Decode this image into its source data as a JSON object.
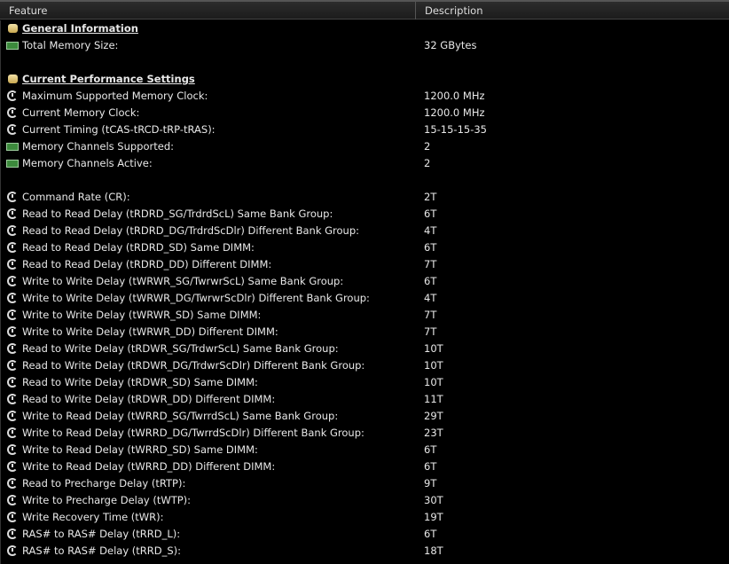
{
  "header": {
    "feature": "Feature",
    "description": "Description"
  },
  "rows": [
    {
      "type": "section",
      "icon": "database-icon",
      "label": "General Information",
      "value": ""
    },
    {
      "type": "item",
      "icon": "memory-module-icon",
      "label": "Total Memory Size:",
      "value": "32 GBytes"
    },
    {
      "type": "blank",
      "label": "",
      "value": ""
    },
    {
      "type": "section",
      "icon": "database-icon",
      "label": "Current Performance Settings",
      "value": ""
    },
    {
      "type": "item",
      "icon": "clock-icon",
      "label": "Maximum Supported Memory Clock:",
      "value": "1200.0 MHz"
    },
    {
      "type": "item",
      "icon": "clock-icon",
      "label": "Current Memory Clock:",
      "value": "1200.0 MHz"
    },
    {
      "type": "item",
      "icon": "clock-icon",
      "label": "Current Timing (tCAS-tRCD-tRP-tRAS):",
      "value": "15-15-15-35"
    },
    {
      "type": "item",
      "icon": "memory-module-icon",
      "label": "Memory Channels Supported:",
      "value": "2"
    },
    {
      "type": "item",
      "icon": "memory-module-icon",
      "label": "Memory Channels Active:",
      "value": "2"
    },
    {
      "type": "blank",
      "label": "",
      "value": ""
    },
    {
      "type": "item",
      "icon": "clock-icon",
      "label": "Command Rate (CR):",
      "value": "2T"
    },
    {
      "type": "item",
      "icon": "clock-icon",
      "label": "Read to Read Delay (tRDRD_SG/TrdrdScL) Same Bank Group:",
      "value": "6T"
    },
    {
      "type": "item",
      "icon": "clock-icon",
      "label": "Read to Read Delay (tRDRD_DG/TrdrdScDlr) Different Bank Group:",
      "value": "4T"
    },
    {
      "type": "item",
      "icon": "clock-icon",
      "label": "Read to Read Delay (tRDRD_SD) Same DIMM:",
      "value": "6T"
    },
    {
      "type": "item",
      "icon": "clock-icon",
      "label": "Read to Read Delay (tRDRD_DD) Different DIMM:",
      "value": "7T"
    },
    {
      "type": "item",
      "icon": "clock-icon",
      "label": "Write to Write Delay (tWRWR_SG/TwrwrScL) Same Bank Group:",
      "value": "6T"
    },
    {
      "type": "item",
      "icon": "clock-icon",
      "label": "Write to Write Delay (tWRWR_DG/TwrwrScDlr) Different Bank Group:",
      "value": "4T"
    },
    {
      "type": "item",
      "icon": "clock-icon",
      "label": "Write to Write Delay (tWRWR_SD) Same DIMM:",
      "value": "7T"
    },
    {
      "type": "item",
      "icon": "clock-icon",
      "label": "Write to Write Delay (tWRWR_DD) Different DIMM:",
      "value": "7T"
    },
    {
      "type": "item",
      "icon": "clock-icon",
      "label": "Read to Write Delay (tRDWR_SG/TrdwrScL) Same Bank Group:",
      "value": "10T"
    },
    {
      "type": "item",
      "icon": "clock-icon",
      "label": "Read to Write Delay (tRDWR_DG/TrdwrScDlr) Different Bank Group:",
      "value": "10T"
    },
    {
      "type": "item",
      "icon": "clock-icon",
      "label": "Read to Write Delay (tRDWR_SD) Same DIMM:",
      "value": "10T"
    },
    {
      "type": "item",
      "icon": "clock-icon",
      "label": "Read to Write Delay (tRDWR_DD) Different DIMM:",
      "value": "11T"
    },
    {
      "type": "item",
      "icon": "clock-icon",
      "label": "Write to Read Delay (tWRRD_SG/TwrrdScL) Same Bank Group:",
      "value": "29T"
    },
    {
      "type": "item",
      "icon": "clock-icon",
      "label": "Write to Read Delay (tWRRD_DG/TwrrdScDlr) Different Bank Group:",
      "value": "23T"
    },
    {
      "type": "item",
      "icon": "clock-icon",
      "label": "Write to Read Delay (tWRRD_SD) Same DIMM:",
      "value": "6T"
    },
    {
      "type": "item",
      "icon": "clock-icon",
      "label": "Write to Read Delay (tWRRD_DD) Different DIMM:",
      "value": "6T"
    },
    {
      "type": "item",
      "icon": "clock-icon",
      "label": "Read to Precharge Delay (tRTP):",
      "value": "9T"
    },
    {
      "type": "item",
      "icon": "clock-icon",
      "label": "Write to Precharge Delay (tWTP):",
      "value": "30T"
    },
    {
      "type": "item",
      "icon": "clock-icon",
      "label": "Write Recovery Time (tWR):",
      "value": "19T"
    },
    {
      "type": "item",
      "icon": "clock-icon",
      "label": "RAS# to RAS# Delay (tRRD_L):",
      "value": "6T"
    },
    {
      "type": "item",
      "icon": "clock-icon",
      "label": "RAS# to RAS# Delay (tRRD_S):",
      "value": "18T"
    }
  ]
}
